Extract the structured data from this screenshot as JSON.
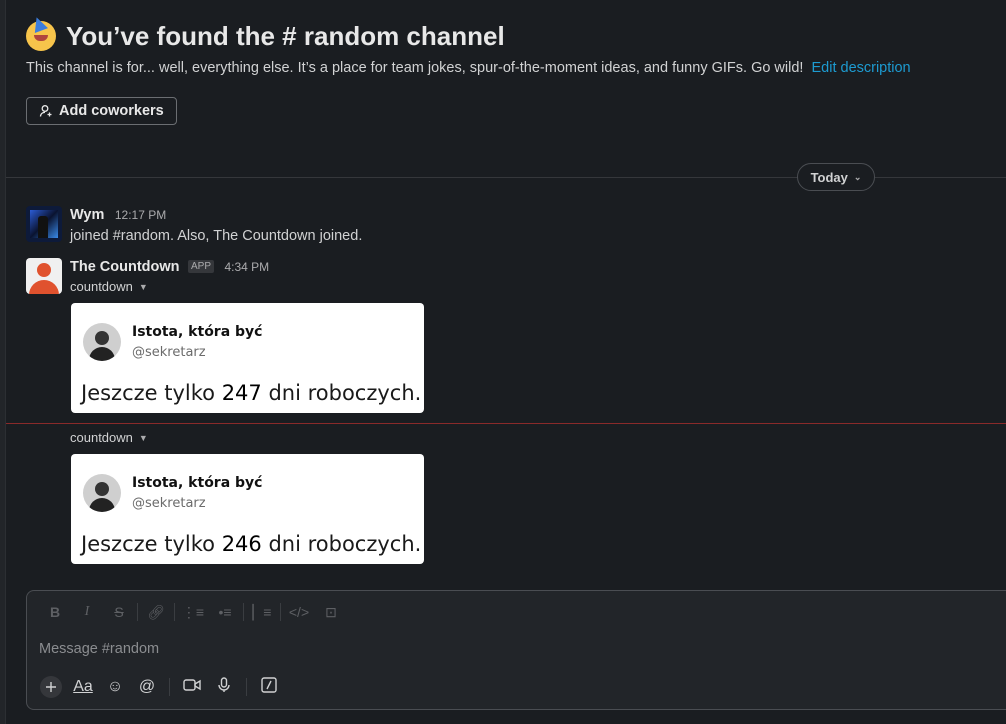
{
  "channel_intro": {
    "title": "You’ve found the # random channel",
    "description": "This channel is for... well, everything else. It’s a place for team jokes, spur-of-the-moment ideas, and funny GIFs. Go wild!",
    "edit_link": "Edit description",
    "add_button": "Add coworkers"
  },
  "date_divider": "Today",
  "messages": [
    {
      "author": "Wym",
      "time": "12:17 PM",
      "text": "joined #random. Also, The Countdown joined."
    },
    {
      "author": "The Countdown",
      "badge": "APP",
      "time": "4:34 PM",
      "attachments": [
        {
          "label": "countdown",
          "card_name": "Istota, która być",
          "card_handle": "@sekretarz",
          "quote_before": "Jeszcze tylko ",
          "quote_number": "247",
          "quote_after": " dni roboczych."
        },
        {
          "label": "countdown",
          "card_name": "Istota, która być",
          "card_handle": "@sekretarz",
          "quote_before": "Jeszcze tylko ",
          "quote_number": "246",
          "quote_after": " dni roboczych."
        }
      ]
    }
  ],
  "composer": {
    "placeholder": "Message #random",
    "format_icons": [
      "bold-icon",
      "italic-icon",
      "strikethrough-icon",
      "link-icon",
      "ordered-list-icon",
      "bullet-list-icon",
      "blockquote-icon",
      "code-icon",
      "code-block-icon"
    ],
    "action_icons": [
      "plus-icon",
      "text-format-icon",
      "emoji-icon",
      "mention-icon",
      "video-icon",
      "microphone-icon",
      "slash-command-icon"
    ]
  },
  "colors": {
    "background": "#1a1d21",
    "link": "#1d9bd1",
    "new_message_line": "#8a2a2a"
  }
}
